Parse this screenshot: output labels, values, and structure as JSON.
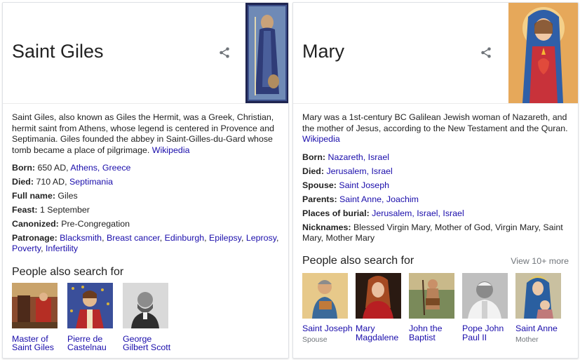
{
  "left": {
    "title": "Saint Giles",
    "description": "Saint Giles, also known as Giles the Hermit, was a Greek, Christian, hermit saint from Athens, whose legend is centered in Provence and Septimania. Giles founded the abbey in Saint-Gilles-du-Gard whose tomb became a place of pilgrimage.",
    "source": "Wikipedia",
    "facts": {
      "born_label": "Born:",
      "born_text": "650 AD, ",
      "born_link": "Athens, Greece",
      "died_label": "Died:",
      "died_text": "710 AD, ",
      "died_link": "Septimania",
      "fullname_label": "Full name:",
      "fullname_value": "Giles",
      "feast_label": "Feast:",
      "feast_value": "1 September",
      "canonized_label": "Canonized:",
      "canonized_value": "Pre-Congregation",
      "patronage_label": "Patronage:",
      "patronage_links": [
        "Blacksmith",
        "Breast cancer",
        "Edinburgh",
        "Epilepsy",
        "Leprosy",
        "Poverty",
        "Infertility"
      ]
    },
    "people_title": "People also search for",
    "people": [
      {
        "name": "Master of Saint Giles"
      },
      {
        "name": "Pierre de Castelnau"
      },
      {
        "name": "George Gilbert Scott"
      }
    ]
  },
  "right": {
    "title": "Mary",
    "description": "Mary was a 1st-century BC Galilean Jewish woman of Nazareth, and the mother of Jesus, according to the New Testament and the Quran.",
    "source": "Wikipedia",
    "facts": {
      "born_label": "Born:",
      "born_link": "Nazareth, Israel",
      "died_label": "Died:",
      "died_link": "Jerusalem, Israel",
      "spouse_label": "Spouse:",
      "spouse_link": "Saint Joseph",
      "parents_label": "Parents:",
      "parents_link": "Saint Anne, Joachim",
      "burial_label": "Places of burial:",
      "burial_link": "Jerusalem, Israel, Israel",
      "nicknames_label": "Nicknames:",
      "nicknames_value": "Blessed Virgin Mary, Mother of God, Virgin Mary, Saint Mary, Mother Mary"
    },
    "people_title": "People also search for",
    "more_label": "View 10+ more",
    "people": [
      {
        "name": "Saint Joseph",
        "sub": "Spouse"
      },
      {
        "name": "Mary Magdalene",
        "sub": ""
      },
      {
        "name": "John the Baptist",
        "sub": ""
      },
      {
        "name": "Pope John Paul II",
        "sub": ""
      },
      {
        "name": "Saint Anne",
        "sub": "Mother"
      }
    ]
  },
  "icons": {
    "share": "share-icon"
  },
  "colors": {
    "link": "#1a0dab",
    "muted": "#70757a",
    "border": "#dfe1e5"
  }
}
